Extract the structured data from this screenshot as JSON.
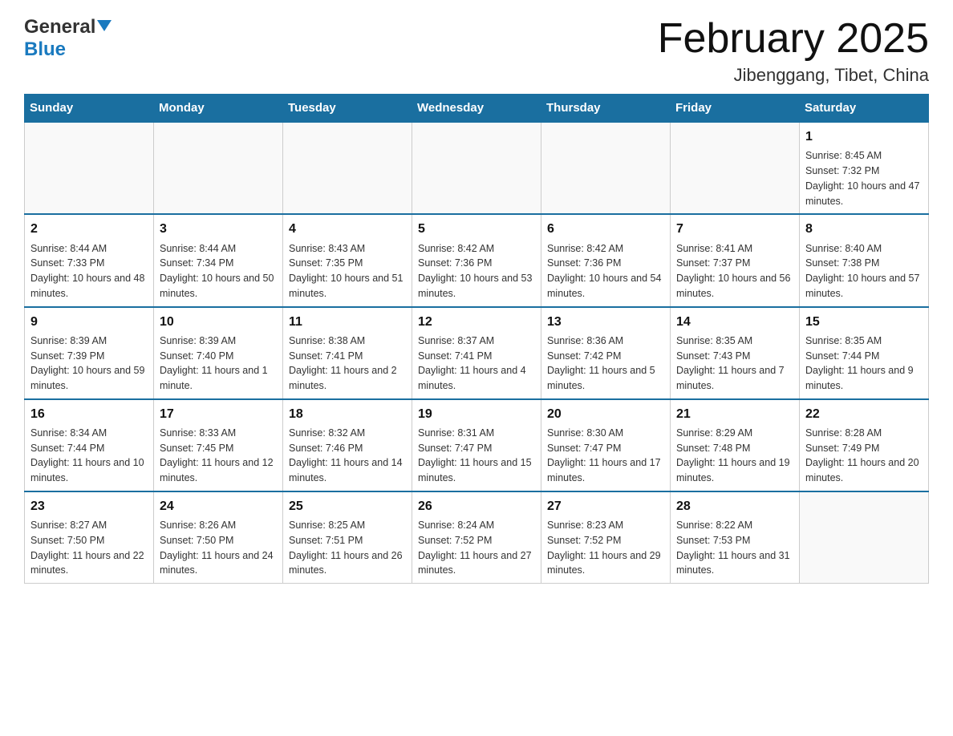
{
  "header": {
    "logo_general": "General",
    "logo_blue": "Blue",
    "month_title": "February 2025",
    "location": "Jibenggang, Tibet, China"
  },
  "days_of_week": [
    "Sunday",
    "Monday",
    "Tuesday",
    "Wednesday",
    "Thursday",
    "Friday",
    "Saturday"
  ],
  "weeks": [
    [
      {
        "day": "",
        "info": ""
      },
      {
        "day": "",
        "info": ""
      },
      {
        "day": "",
        "info": ""
      },
      {
        "day": "",
        "info": ""
      },
      {
        "day": "",
        "info": ""
      },
      {
        "day": "",
        "info": ""
      },
      {
        "day": "1",
        "info": "Sunrise: 8:45 AM\nSunset: 7:32 PM\nDaylight: 10 hours and 47 minutes."
      }
    ],
    [
      {
        "day": "2",
        "info": "Sunrise: 8:44 AM\nSunset: 7:33 PM\nDaylight: 10 hours and 48 minutes."
      },
      {
        "day": "3",
        "info": "Sunrise: 8:44 AM\nSunset: 7:34 PM\nDaylight: 10 hours and 50 minutes."
      },
      {
        "day": "4",
        "info": "Sunrise: 8:43 AM\nSunset: 7:35 PM\nDaylight: 10 hours and 51 minutes."
      },
      {
        "day": "5",
        "info": "Sunrise: 8:42 AM\nSunset: 7:36 PM\nDaylight: 10 hours and 53 minutes."
      },
      {
        "day": "6",
        "info": "Sunrise: 8:42 AM\nSunset: 7:36 PM\nDaylight: 10 hours and 54 minutes."
      },
      {
        "day": "7",
        "info": "Sunrise: 8:41 AM\nSunset: 7:37 PM\nDaylight: 10 hours and 56 minutes."
      },
      {
        "day": "8",
        "info": "Sunrise: 8:40 AM\nSunset: 7:38 PM\nDaylight: 10 hours and 57 minutes."
      }
    ],
    [
      {
        "day": "9",
        "info": "Sunrise: 8:39 AM\nSunset: 7:39 PM\nDaylight: 10 hours and 59 minutes."
      },
      {
        "day": "10",
        "info": "Sunrise: 8:39 AM\nSunset: 7:40 PM\nDaylight: 11 hours and 1 minute."
      },
      {
        "day": "11",
        "info": "Sunrise: 8:38 AM\nSunset: 7:41 PM\nDaylight: 11 hours and 2 minutes."
      },
      {
        "day": "12",
        "info": "Sunrise: 8:37 AM\nSunset: 7:41 PM\nDaylight: 11 hours and 4 minutes."
      },
      {
        "day": "13",
        "info": "Sunrise: 8:36 AM\nSunset: 7:42 PM\nDaylight: 11 hours and 5 minutes."
      },
      {
        "day": "14",
        "info": "Sunrise: 8:35 AM\nSunset: 7:43 PM\nDaylight: 11 hours and 7 minutes."
      },
      {
        "day": "15",
        "info": "Sunrise: 8:35 AM\nSunset: 7:44 PM\nDaylight: 11 hours and 9 minutes."
      }
    ],
    [
      {
        "day": "16",
        "info": "Sunrise: 8:34 AM\nSunset: 7:44 PM\nDaylight: 11 hours and 10 minutes."
      },
      {
        "day": "17",
        "info": "Sunrise: 8:33 AM\nSunset: 7:45 PM\nDaylight: 11 hours and 12 minutes."
      },
      {
        "day": "18",
        "info": "Sunrise: 8:32 AM\nSunset: 7:46 PM\nDaylight: 11 hours and 14 minutes."
      },
      {
        "day": "19",
        "info": "Sunrise: 8:31 AM\nSunset: 7:47 PM\nDaylight: 11 hours and 15 minutes."
      },
      {
        "day": "20",
        "info": "Sunrise: 8:30 AM\nSunset: 7:47 PM\nDaylight: 11 hours and 17 minutes."
      },
      {
        "day": "21",
        "info": "Sunrise: 8:29 AM\nSunset: 7:48 PM\nDaylight: 11 hours and 19 minutes."
      },
      {
        "day": "22",
        "info": "Sunrise: 8:28 AM\nSunset: 7:49 PM\nDaylight: 11 hours and 20 minutes."
      }
    ],
    [
      {
        "day": "23",
        "info": "Sunrise: 8:27 AM\nSunset: 7:50 PM\nDaylight: 11 hours and 22 minutes."
      },
      {
        "day": "24",
        "info": "Sunrise: 8:26 AM\nSunset: 7:50 PM\nDaylight: 11 hours and 24 minutes."
      },
      {
        "day": "25",
        "info": "Sunrise: 8:25 AM\nSunset: 7:51 PM\nDaylight: 11 hours and 26 minutes."
      },
      {
        "day": "26",
        "info": "Sunrise: 8:24 AM\nSunset: 7:52 PM\nDaylight: 11 hours and 27 minutes."
      },
      {
        "day": "27",
        "info": "Sunrise: 8:23 AM\nSunset: 7:52 PM\nDaylight: 11 hours and 29 minutes."
      },
      {
        "day": "28",
        "info": "Sunrise: 8:22 AM\nSunset: 7:53 PM\nDaylight: 11 hours and 31 minutes."
      },
      {
        "day": "",
        "info": ""
      }
    ]
  ]
}
